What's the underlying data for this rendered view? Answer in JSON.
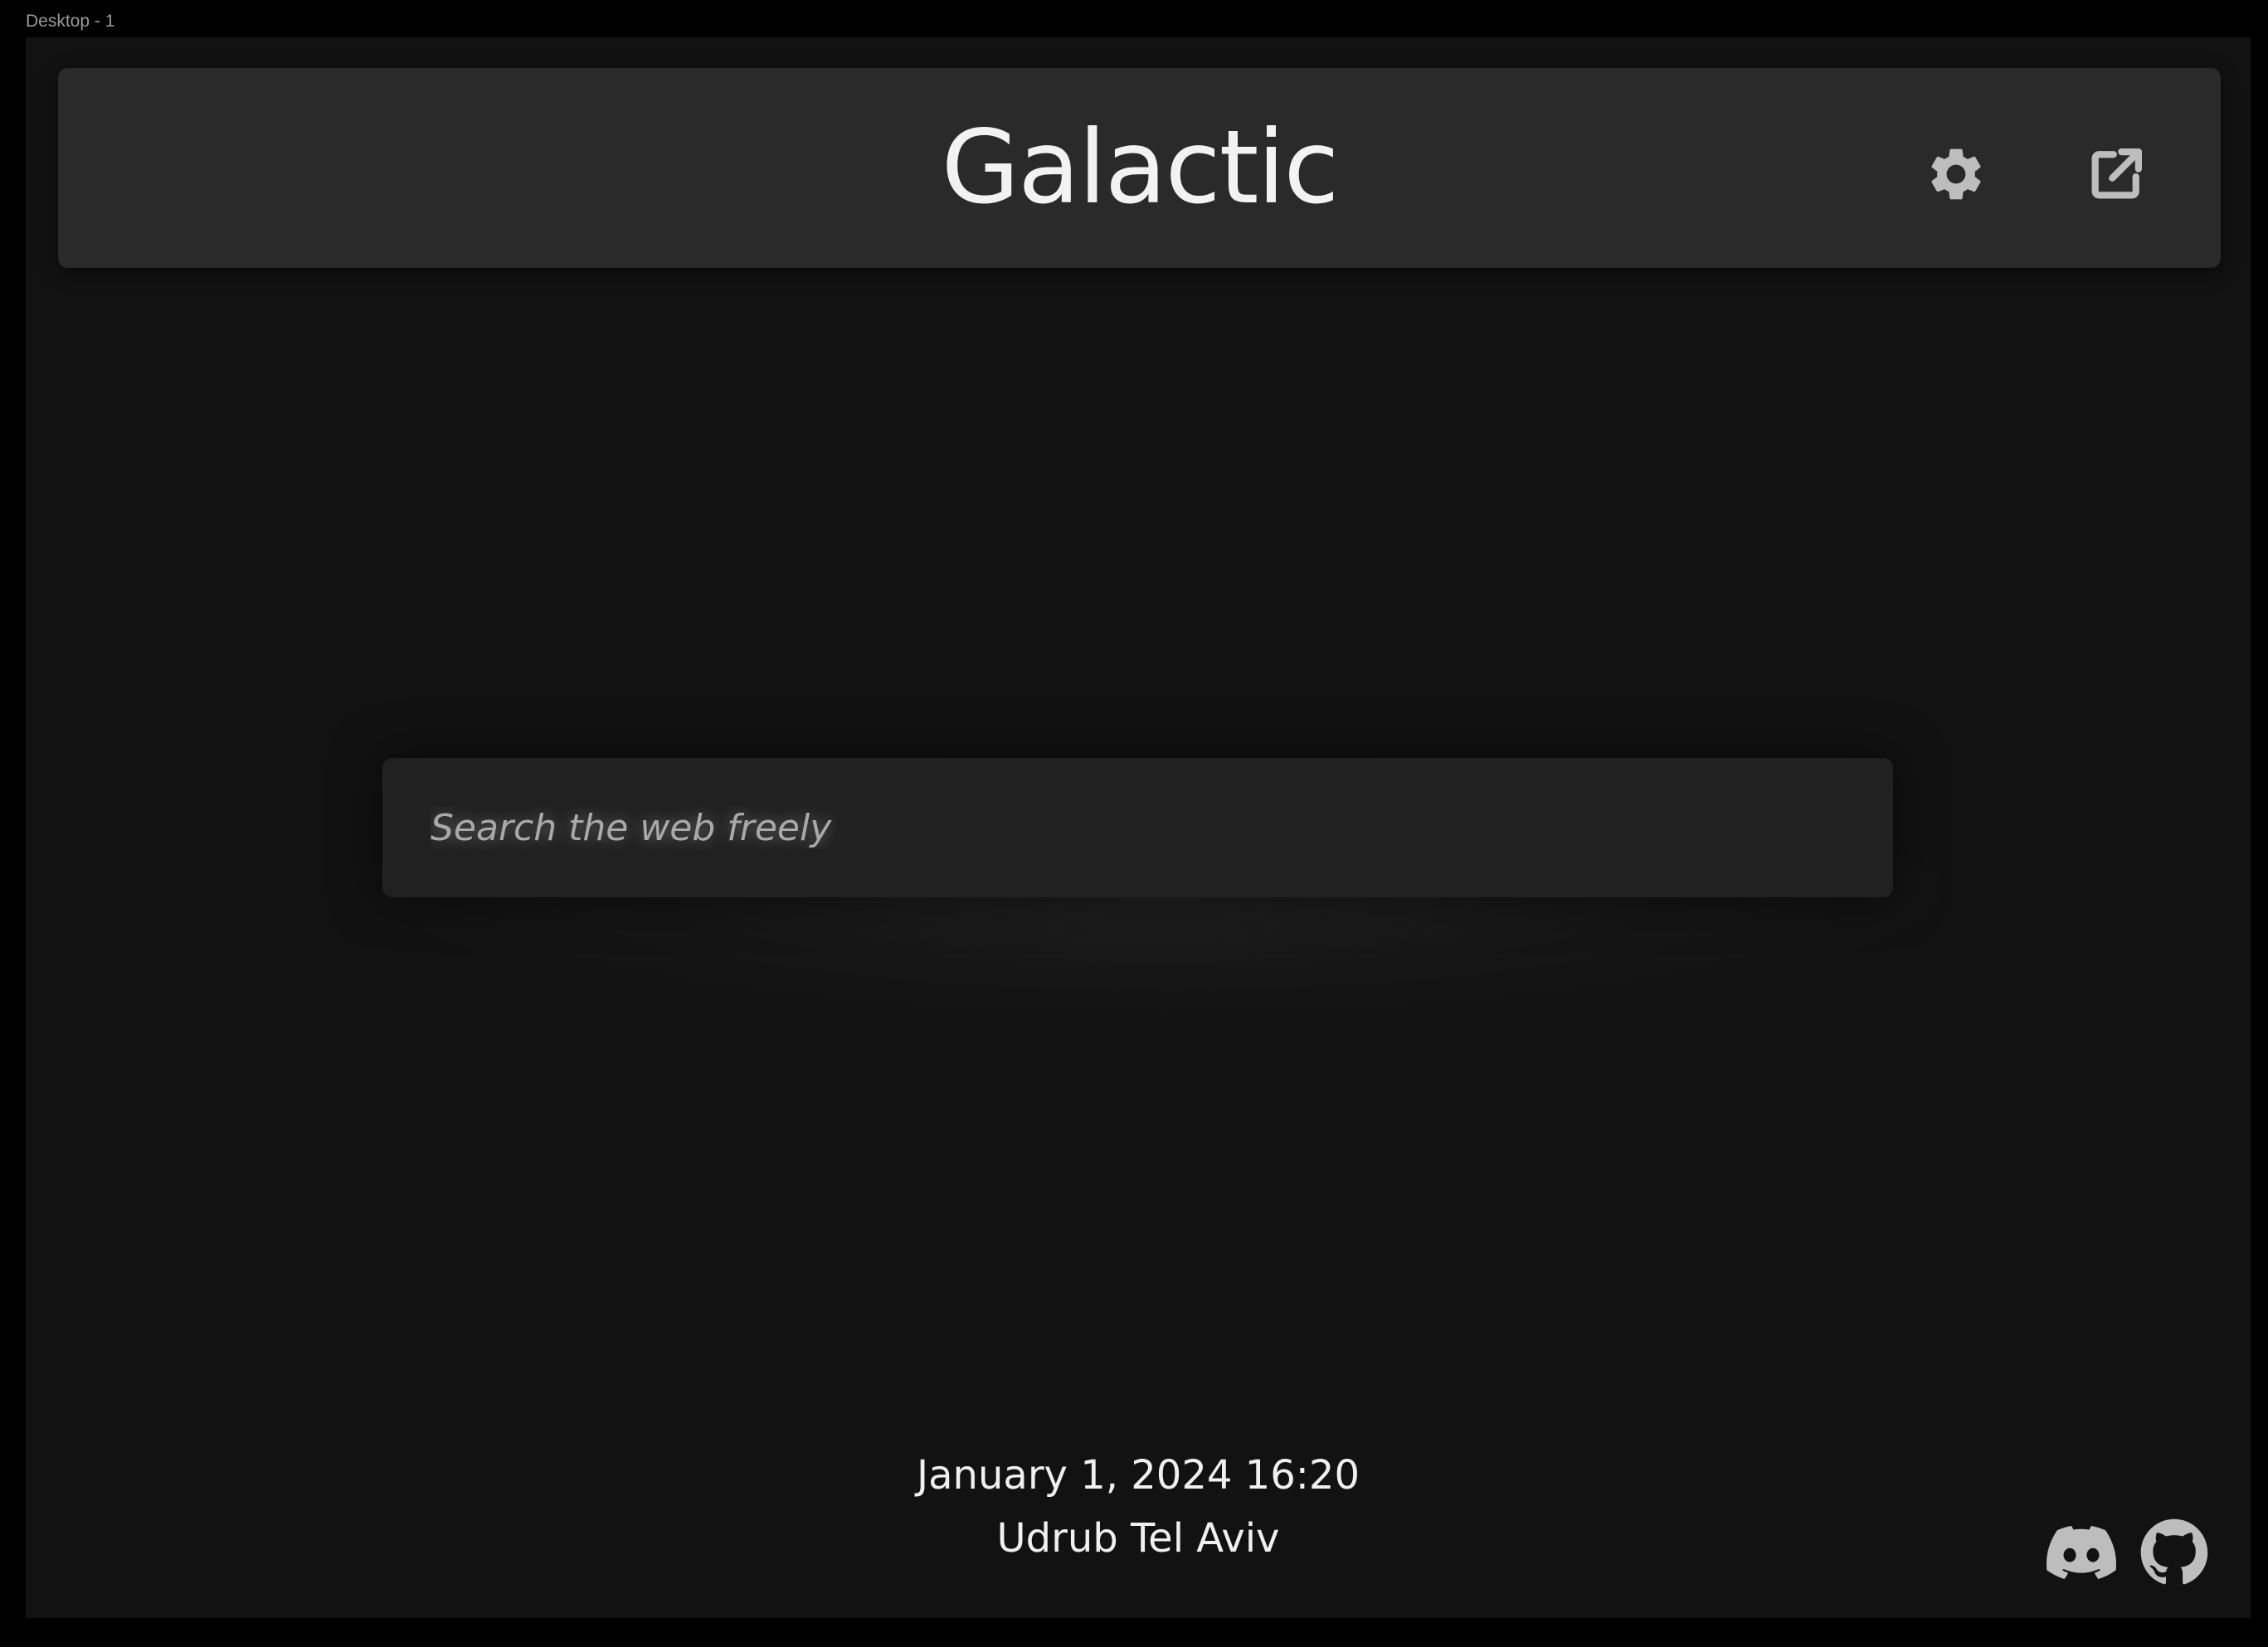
{
  "frame": {
    "label": "Desktop - 1"
  },
  "header": {
    "brand": "Galactic",
    "settings_icon": "gear-icon",
    "open_external_icon": "open-in-new-icon"
  },
  "search": {
    "placeholder": "Search the web freely",
    "value": ""
  },
  "footer": {
    "datetime": "January 1, 2024 16:20",
    "location": "Udrub Tel Aviv",
    "social": [
      {
        "icon": "discord-icon"
      },
      {
        "icon": "github-icon"
      }
    ]
  },
  "colors": {
    "page_background": "#121212",
    "header_background": "#2a2a2a",
    "search_background": "#212121",
    "text": "#f0f0f0",
    "icon": "#bdbdbd"
  }
}
